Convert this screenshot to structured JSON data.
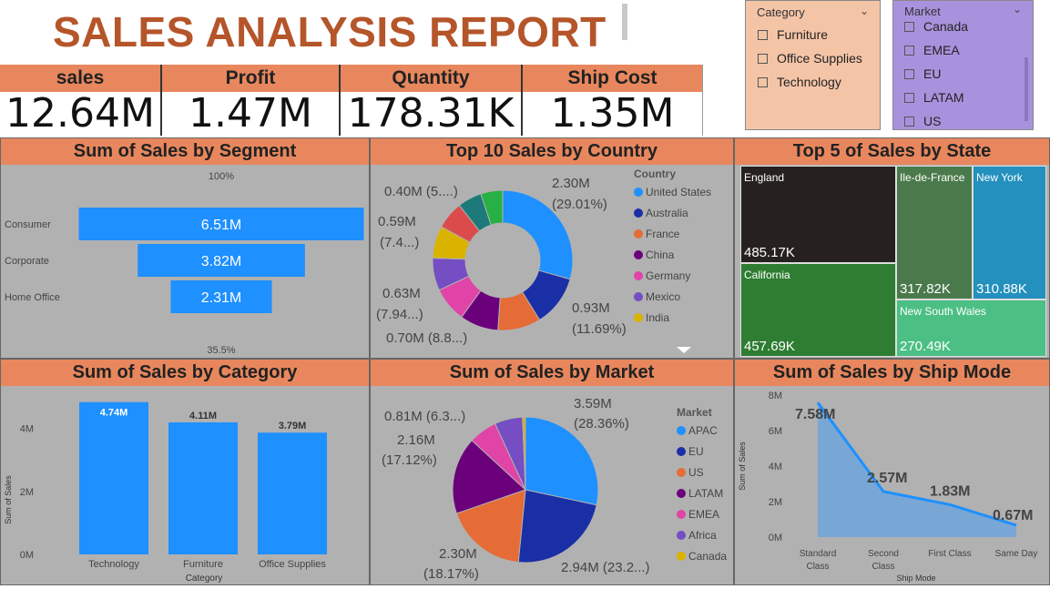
{
  "title": "SALES ANALYSIS REPORT",
  "kpis": [
    {
      "label": "sales",
      "value": "12.64M"
    },
    {
      "label": "Profit",
      "value": "1.47M"
    },
    {
      "label": "Quantity",
      "value": "178.31K"
    },
    {
      "label": "Ship Cost",
      "value": "1.35M"
    }
  ],
  "slicers": {
    "category": {
      "title": "Category",
      "items": [
        "Furniture",
        "Office Supplies",
        "Technology"
      ]
    },
    "market": {
      "title": "Market",
      "items": [
        "Canada",
        "EMEA",
        "EU",
        "LATAM",
        "US"
      ]
    }
  },
  "panels": {
    "segment": {
      "title": "Sum of Sales by Segment"
    },
    "country": {
      "title": "Top 10 Sales by Country"
    },
    "state": {
      "title": "Top 5 of Sales by State"
    },
    "category": {
      "title": "Sum of Sales by Category"
    },
    "market": {
      "title": "Sum of Sales by Market"
    },
    "shipmode": {
      "title": "Sum of Sales by Ship Mode"
    }
  },
  "colors": {
    "accent": "#e8875d",
    "bar": "#1e90ff",
    "panel_bg": "#b1b1b1",
    "title": "#b5552a",
    "category_slicer_bg": "#f4c4a7",
    "market_slicer_bg": "#a992dd"
  },
  "chart_data": [
    {
      "id": "segment",
      "type": "bar",
      "categories": [
        "Consumer",
        "Corporate",
        "Home Office"
      ],
      "values": [
        6.51,
        3.82,
        2.31
      ],
      "data_labels": [
        "6.51M",
        "3.82M",
        "2.31M"
      ],
      "top_label": "100%",
      "bottom_label": "35.5%"
    },
    {
      "id": "country",
      "type": "pie",
      "legend_title": "Country",
      "legend": [
        "United States",
        "Australia",
        "France",
        "China",
        "Germany",
        "Mexico",
        "India"
      ],
      "legend_colors": [
        "#1e90ff",
        "#1a2fa6",
        "#e66c37",
        "#6b007b",
        "#e044a7",
        "#744ec2",
        "#d9b300"
      ],
      "slices": [
        {
          "value": 29.01,
          "color": "#1e90ff"
        },
        {
          "value": 11.69,
          "color": "#1a2fa6"
        },
        {
          "value": 9.8,
          "color": "#e66c37"
        },
        {
          "value": 8.8,
          "color": "#6b007b"
        },
        {
          "value": 7.94,
          "color": "#e044a7"
        },
        {
          "value": 7.4,
          "color": "#744ec2"
        },
        {
          "value": 7.4,
          "color": "#d9b300"
        },
        {
          "value": 6.3,
          "color": "#dc4b4b"
        },
        {
          "value": 5.5,
          "color": "#1c7a7a"
        },
        {
          "value": 5.0,
          "color": "#27b044"
        }
      ],
      "labels": [
        "2.30M",
        "(29.01%)",
        "0.93M",
        "(11.69%)",
        "0.70M (8.8...)",
        "0.63M",
        "(7.94...)",
        "0.59M",
        "(7.4...)",
        "0.40M (5....)"
      ]
    },
    {
      "id": "state",
      "type": "table",
      "items": [
        {
          "label": "England",
          "value": "485.17K",
          "color": "#26211f"
        },
        {
          "label": "California",
          "value": "457.69K",
          "color": "#2e7d32"
        },
        {
          "label": "Ile-de-France",
          "value": "317.82K",
          "color": "#4a7a4c"
        },
        {
          "label": "New York",
          "value": "310.88K",
          "color": "#2390bd"
        },
        {
          "label": "New South Wales",
          "value": "270.49K",
          "color": "#4cbf84"
        }
      ]
    },
    {
      "id": "category",
      "type": "bar",
      "categories": [
        "Technology",
        "Furniture",
        "Office Supplies"
      ],
      "values": [
        4.74,
        4.11,
        3.79
      ],
      "data_labels": [
        "4.74M",
        "4.11M",
        "3.79M"
      ],
      "ylabel": "Sum of Sales",
      "xlabel": "Category",
      "yticks": [
        "0M",
        "2M",
        "4M"
      ],
      "ylim": [
        0,
        5.0
      ]
    },
    {
      "id": "market",
      "type": "pie",
      "legend_title": "Market",
      "legend": [
        "APAC",
        "EU",
        "US",
        "LATAM",
        "EMEA",
        "Africa",
        "Canada"
      ],
      "legend_colors": [
        "#1e90ff",
        "#1a2fa6",
        "#e66c37",
        "#6b007b",
        "#e044a7",
        "#744ec2",
        "#d9b300"
      ],
      "slices": [
        {
          "value": 28.36,
          "color": "#1e90ff"
        },
        {
          "value": 23.2,
          "color": "#1a2fa6"
        },
        {
          "value": 18.17,
          "color": "#e66c37"
        },
        {
          "value": 17.12,
          "color": "#6b007b"
        },
        {
          "value": 6.3,
          "color": "#e044a7"
        },
        {
          "value": 6.2,
          "color": "#744ec2"
        },
        {
          "value": 0.65,
          "color": "#d9b300"
        }
      ],
      "labels": [
        "3.59M",
        "(28.36%)",
        "2.94M (23.2...)",
        "2.30M",
        "(18.17%)",
        "2.16M",
        "(17.12%)",
        "0.81M (6.3...)"
      ]
    },
    {
      "id": "shipmode",
      "type": "area",
      "categories": [
        "Standard Class",
        "Second Class",
        "First Class",
        "Same Day"
      ],
      "category_lines": [
        [
          "Standard",
          "Class"
        ],
        [
          "Second",
          "Class"
        ],
        [
          "First Class"
        ],
        [
          "Same Day"
        ]
      ],
      "values": [
        7.58,
        2.57,
        1.83,
        0.67
      ],
      "data_labels": [
        "7.58M",
        "2.57M",
        "1.83M",
        "0.67M"
      ],
      "ylabel": "Sum of Sales",
      "xlabel": "Ship Mode",
      "yticks": [
        "0M",
        "2M",
        "4M",
        "6M",
        "8M"
      ],
      "ylim": [
        0,
        8
      ]
    }
  ]
}
